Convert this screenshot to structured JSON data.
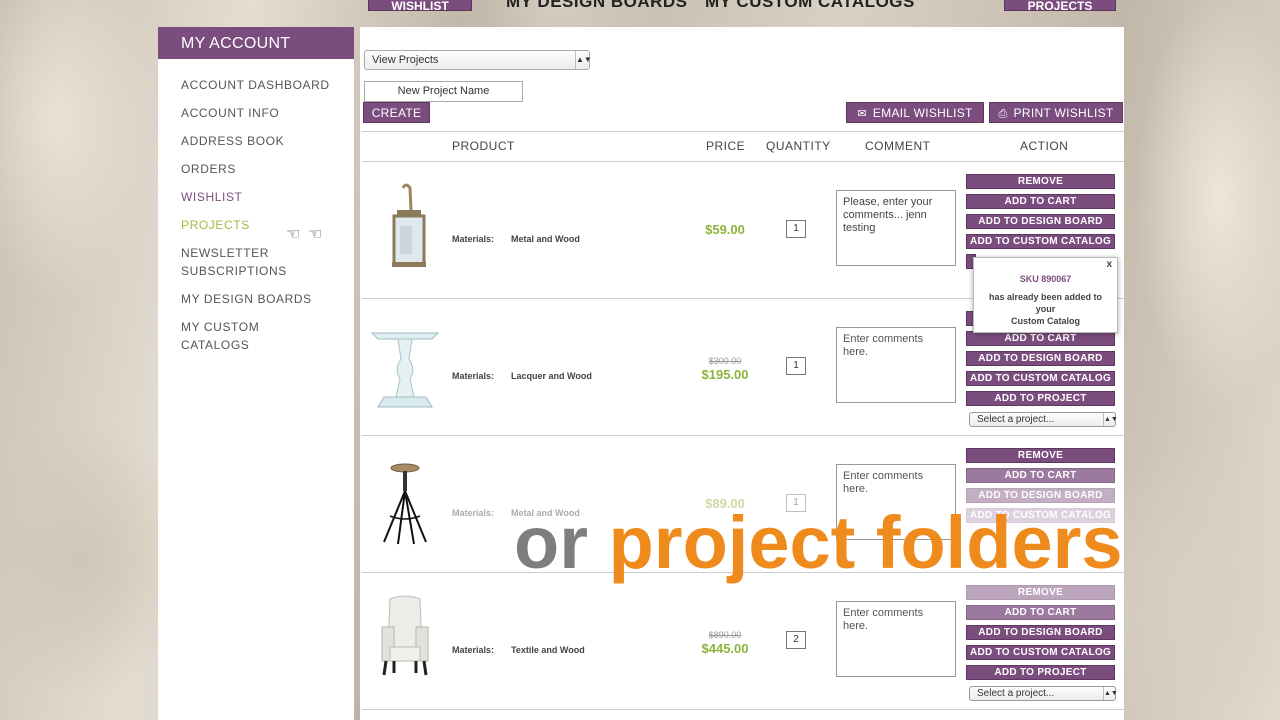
{
  "topnav": {
    "wishlist_tab": "WISHLIST",
    "design_boards": "MY DESIGN BOARDS",
    "custom_catalogs": "MY CUSTOM CATALOGS",
    "projects_tab": "PROJECTS"
  },
  "sidebar": {
    "title": "MY ACCOUNT",
    "items": [
      {
        "label": "ACCOUNT DASHBOARD"
      },
      {
        "label": "ACCOUNT INFO"
      },
      {
        "label": "ADDRESS BOOK"
      },
      {
        "label": "ORDERS"
      },
      {
        "label": "WISHLIST"
      },
      {
        "label": "PROJECTS"
      },
      {
        "label": "NEWSLETTER SUBSCRIPTIONS"
      },
      {
        "label": "MY DESIGN BOARDS"
      },
      {
        "label": "MY CUSTOM CATALOGS"
      }
    ]
  },
  "toolbar": {
    "view_select": "View Projects",
    "new_project_placeholder": "New Project Name",
    "create": "CREATE",
    "email": "EMAIL WISHLIST",
    "print": "PRINT WISHLIST"
  },
  "table": {
    "headers": {
      "product": "PRODUCT",
      "price": "PRICE",
      "quantity": "QUANTITY",
      "comment": "COMMENT",
      "action": "ACTION"
    },
    "materials_label": "Materials:",
    "actions": {
      "remove": "REMOVE",
      "add_to_cart": "ADD TO CART",
      "add_to_design_board": "ADD TO DESIGN BOARD",
      "add_to_custom_catalog": "ADD TO CUSTOM CATALOG",
      "add_to_project": "ADD TO PROJECT",
      "select_project": "Select a project..."
    },
    "rows": [
      {
        "materials": "Metal and Wood",
        "old_price": "",
        "price": "$59.00",
        "qty": "1",
        "comment": "Please, enter your comments... jenn testing"
      },
      {
        "materials": "Lacquer and Wood",
        "old_price": "$300.00",
        "price": "$195.00",
        "qty": "1",
        "comment": "Enter comments here."
      },
      {
        "materials": "Metal and Wood",
        "old_price": "",
        "price": "$89.00",
        "qty": "1",
        "comment": "Enter comments here."
      },
      {
        "materials": "Textile and Wood",
        "old_price": "$890.00",
        "price": "$445.00",
        "qty": "2",
        "comment": "Enter comments here."
      }
    ]
  },
  "popup": {
    "close": "x",
    "sku": "SKU 890067",
    "message_1": "has already been added to",
    "message_2": "your",
    "message_3": "Custom Catalog"
  },
  "overlay": {
    "word_1": "or",
    "word_2": "project folders"
  },
  "colors": {
    "brand_purple": "#7b4d7e",
    "price_green": "#8db33a",
    "overlay_orange": "#ef8a1c"
  }
}
